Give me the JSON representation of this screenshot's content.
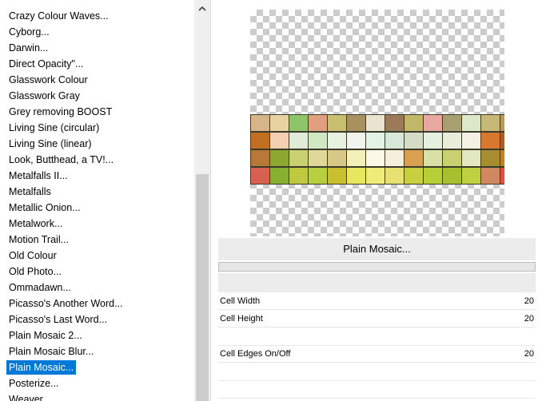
{
  "filter_list": {
    "items": [
      {
        "label": "Crazy Colour Waves..."
      },
      {
        "label": "Cyborg..."
      },
      {
        "label": "Darwin..."
      },
      {
        "label": "Direct Opacity\"..."
      },
      {
        "label": "Glasswork Colour"
      },
      {
        "label": "Glasswork Gray"
      },
      {
        "label": "Grey removing BOOST"
      },
      {
        "label": "Living Sine (circular)"
      },
      {
        "label": "Living Sine (linear)"
      },
      {
        "label": "Look, Butthead, a TV!..."
      },
      {
        "label": "Metalfalls II..."
      },
      {
        "label": "Metalfalls"
      },
      {
        "label": "Metallic Onion..."
      },
      {
        "label": "Metalwork..."
      },
      {
        "label": "Motion Trail..."
      },
      {
        "label": "Old Colour"
      },
      {
        "label": "Old Photo..."
      },
      {
        "label": "Ommadawn..."
      },
      {
        "label": "Picasso's Another Word..."
      },
      {
        "label": "Picasso's Last Word..."
      },
      {
        "label": "Plain Mosaic 2..."
      },
      {
        "label": "Plain Mosaic Blur..."
      },
      {
        "label": "Plain Mosaic...",
        "selected": true
      },
      {
        "label": "Posterize..."
      },
      {
        "label": "Weaver..."
      }
    ]
  },
  "scrollbar": {
    "up_icon": "chevron-up-icon"
  },
  "preview": {
    "mosaic_rows": [
      [
        "#d8b48a",
        "#e8d2a0",
        "#8ec46a",
        "#e0a080",
        "#c8c070",
        "#a89060",
        "#e8e4d0",
        "#9a7a58",
        "#c0b868",
        "#e8a8a0",
        "#a8a070",
        "#dce8c8",
        "#c8b878",
        "#b89860"
      ],
      [
        "#c07020",
        "#f4d0b0",
        "#e0ecd8",
        "#d0e8c4",
        "#e8f0e0",
        "#f0f4ec",
        "#e4f4e4",
        "#d8e8d8",
        "#d4dcc8",
        "#e4f0e0",
        "#e8ecd8",
        "#f4f0e4",
        "#d87830",
        "#a86028"
      ],
      [
        "#b87838",
        "#8ca830",
        "#c8d070",
        "#e0d898",
        "#d8c888",
        "#f4eeb8",
        "#fcf8e8",
        "#f4f0dc",
        "#d8a050",
        "#d8e0a8",
        "#c8d070",
        "#e4e8c0",
        "#a88c30",
        "#c08030"
      ],
      [
        "#d86050",
        "#88b030",
        "#c0c840",
        "#b8d040",
        "#c8c030",
        "#e8e860",
        "#f0ec78",
        "#e8e070",
        "#c8d040",
        "#b8d038",
        "#a8c030",
        "#c0d040",
        "#d08860",
        "#e05040"
      ]
    ]
  },
  "panel": {
    "filter_title": "Plain Mosaic...",
    "params": [
      {
        "label": "Cell Width",
        "value": "20"
      },
      {
        "label": "Cell Height",
        "value": "20"
      },
      {
        "label": "Cell Edges On/Off",
        "value": "20"
      }
    ]
  }
}
